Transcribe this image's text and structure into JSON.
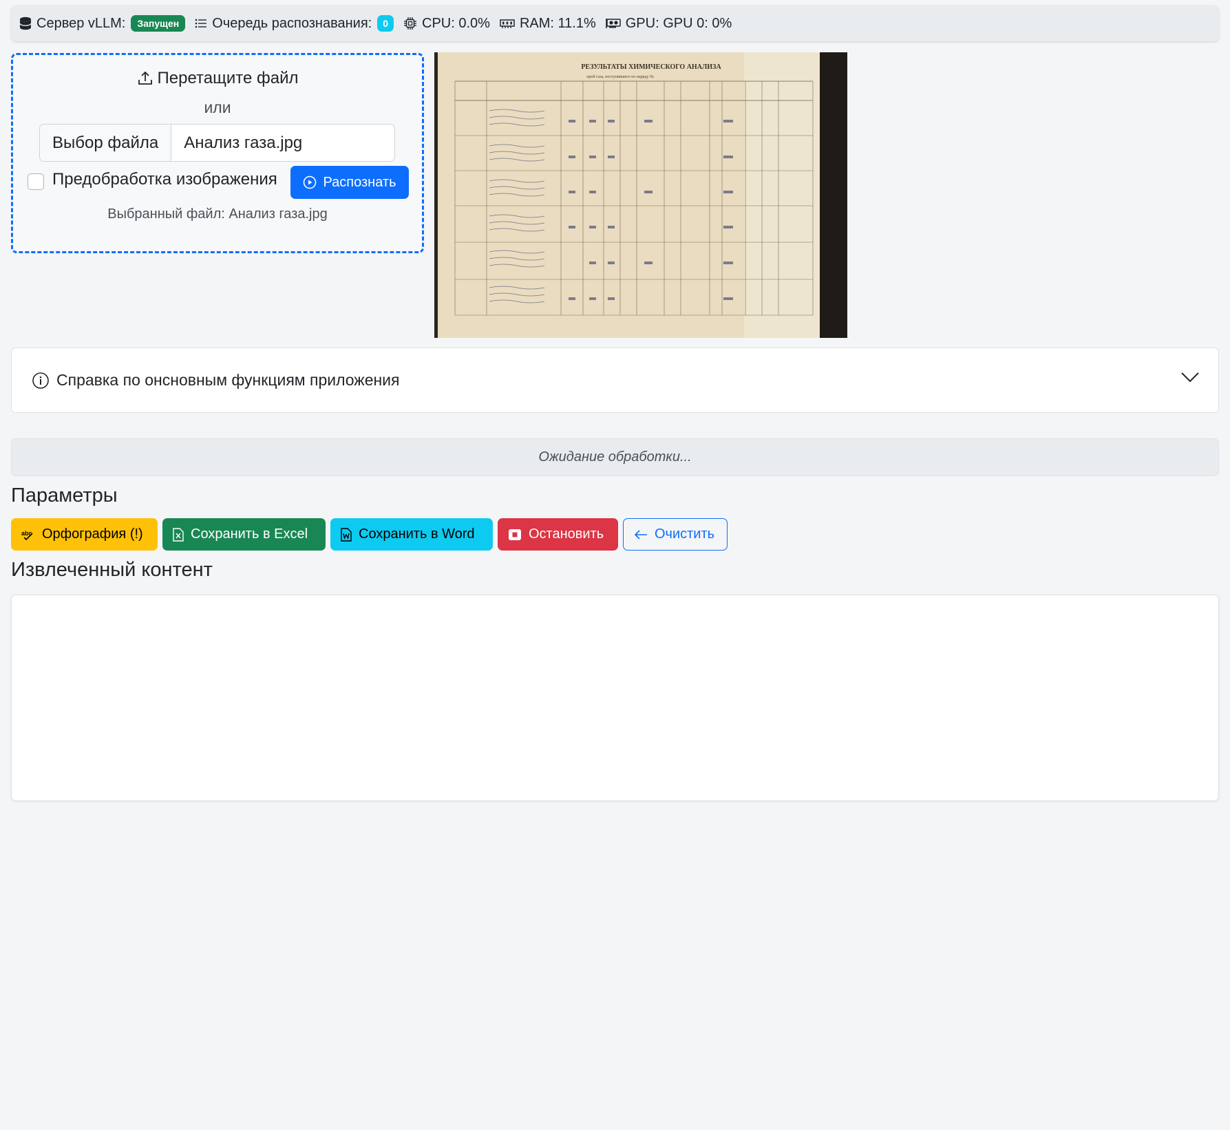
{
  "status_bar": {
    "server_label": "Сервер vLLM:",
    "server_badge": "Запущен",
    "queue_label": "Очередь распознавания:",
    "queue_count": "0",
    "cpu": "CPU: 0.0%",
    "ram": "RAM: 11.1%",
    "gpu": "GPU: GPU 0: 0%"
  },
  "upload": {
    "drop_title": "Перетащите файл",
    "or_text": "или",
    "choose_file_button": "Выбор файла",
    "file_name": "Анализ газа.jpg",
    "preprocess_label": "Предобработка изображения",
    "preprocess_checked": false,
    "recognize_button": "Распознать",
    "selected_file_text": "Выбранный файл: Анализ газа.jpg"
  },
  "preview": {
    "doc_heading": "РЕЗУЛЬТАТЫ ХИМИЧЕСКОГО АНАЛИЗА",
    "doc_subheading": "проб газа, поступившего по наряду №"
  },
  "help": {
    "title": "Справка по онсновным функциям приложения"
  },
  "progress": {
    "status_text": "Ожидание обработки..."
  },
  "params": {
    "heading": "Параметры",
    "spell_button": "Орфография (!)",
    "excel_button": "Сохранить в Excel",
    "word_button": "Сохранить в Word",
    "stop_button": "Остановить",
    "clear_button": "Очистить"
  },
  "content": {
    "heading": "Извлеченный контент",
    "text": ""
  },
  "colors": {
    "primary": "#0d6efd",
    "success": "#198754",
    "warning": "#ffc107",
    "info": "#0dcaf0",
    "danger": "#dc3545"
  }
}
